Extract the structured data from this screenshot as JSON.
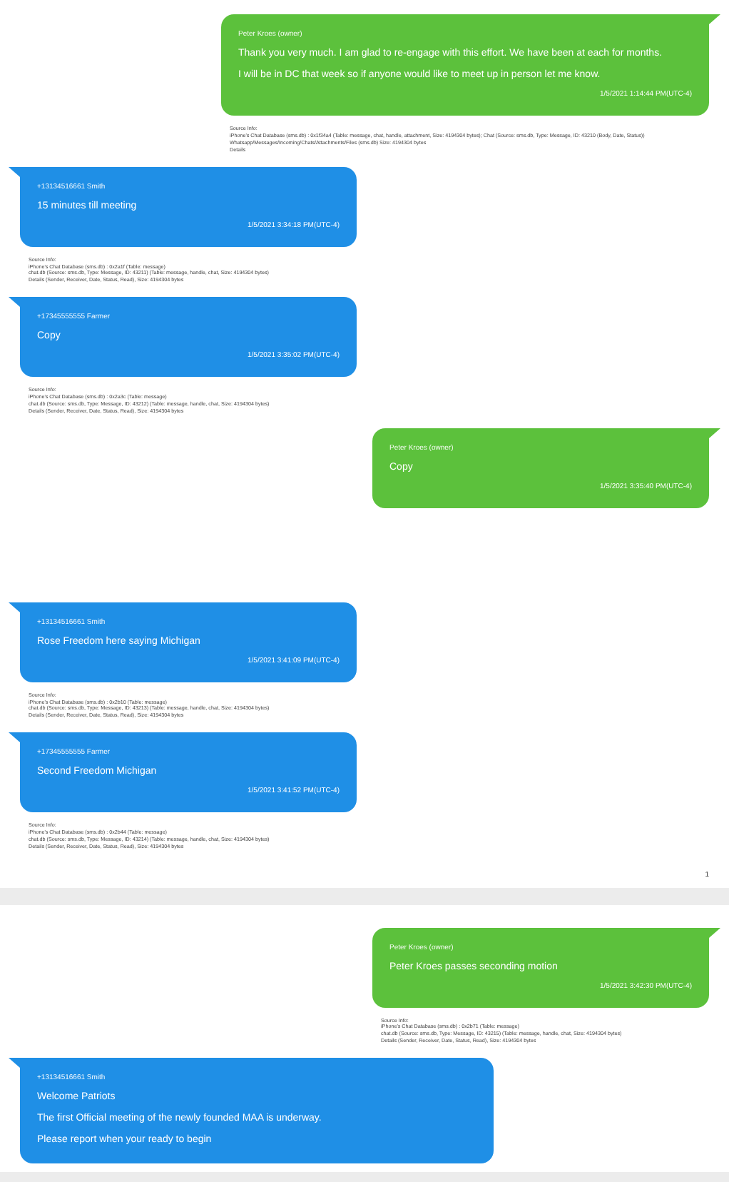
{
  "pages": [
    {
      "groups": [
        {
          "messages": [
            {
              "kind": "outgoing",
              "sender": "Peter Kroes (owner)",
              "lines": [
                "Thank you very much. I am glad to re-engage with this effort. We have been at each for months.",
                "I will be in DC that week so if anyone would like to meet up in person let me know."
              ],
              "timestamp": "1/5/2021 1:14:44 PM(UTC-4)",
              "meta": [
                "Source Info:",
                "iPhone's Chat Database (sms.db) : 0x1f34a4 (Table: message, chat, handle, attachment, Size: 4194304 bytes); Chat (Source: sms.db, Type: Message, ID: 43210 (Body, Date, Status))",
                "Whatsapp/Messages/Incoming/Chats/Attachments/Files (sms.db) Size: 4194304 bytes",
                "Details"
              ]
            },
            {
              "kind": "incoming",
              "sender": "+13134516661 Smith",
              "lines": [
                "15 minutes till meeting"
              ],
              "timestamp": "1/5/2021 3:34:18 PM(UTC-4)",
              "meta": [
                "Source Info:",
                "iPhone's Chat Database (sms.db) : 0x2a1f (Table: message)",
                "chat.db (Source: sms.db, Type: Message, ID: 43211) (Table: message, handle, chat, Size: 4194304 bytes)",
                "Details (Sender, Receiver, Date, Status, Read), Size: 4194304 bytes"
              ]
            },
            {
              "kind": "incoming",
              "sender": "+17345555555 Farmer",
              "lines": [
                "Copy"
              ],
              "timestamp": "1/5/2021 3:35:02 PM(UTC-4)",
              "meta": [
                "Source Info:",
                "iPhone's Chat Database (sms.db) : 0x2a3c (Table: message)",
                "chat.db (Source: sms.db, Type: Message, ID: 43212) (Table: message, handle, chat, Size: 4194304 bytes)",
                "Details (Sender, Receiver, Date, Status, Read), Size: 4194304 bytes"
              ]
            },
            {
              "kind": "outgoing",
              "sender": "Peter Kroes (owner)",
              "lines": [
                "Copy"
              ],
              "timestamp": "1/5/2021 3:35:40 PM(UTC-4)"
            }
          ]
        },
        {
          "messages": [
            {
              "kind": "incoming",
              "sender": "+13134516661 Smith",
              "lines": [
                "Rose Freedom here saying Michigan"
              ],
              "timestamp": "1/5/2021 3:41:09 PM(UTC-4)",
              "meta": [
                "Source Info:",
                "iPhone's Chat Database (sms.db) : 0x2b10 (Table: message)",
                "chat.db (Source: sms.db, Type: Message, ID: 43213) (Table: message, handle, chat, Size: 4194304 bytes)",
                "Details (Sender, Receiver, Date, Status, Read), Size: 4194304 bytes"
              ]
            },
            {
              "kind": "incoming",
              "sender": "+17345555555 Farmer",
              "lines": [
                "Second Freedom Michigan"
              ],
              "timestamp": "1/5/2021 3:41:52 PM(UTC-4)",
              "meta": [
                "Source Info:",
                "iPhone's Chat Database (sms.db) : 0x2b44 (Table: message)",
                "chat.db (Source: sms.db, Type: Message, ID: 43214) (Table: message, handle, chat, Size: 4194304 bytes)",
                "Details (Sender, Receiver, Date, Status, Read), Size: 4194304 bytes"
              ]
            }
          ]
        }
      ],
      "page_number": "1"
    },
    {
      "groups": [
        {
          "messages": [
            {
              "kind": "outgoing",
              "sender": "Peter Kroes (owner)",
              "lines": [
                "Peter Kroes passes seconding motion"
              ],
              "timestamp": "1/5/2021 3:42:30 PM(UTC-4)",
              "meta": [
                "Source Info:",
                "iPhone's Chat Database (sms.db) : 0x2b71 (Table: message)",
                "chat.db (Source: sms.db, Type: Message, ID: 43215) (Table: message, handle, chat, Size: 4194304 bytes)",
                "Details (Sender, Receiver, Date, Status, Read), Size: 4194304 bytes"
              ]
            },
            {
              "kind": "wide",
              "sender": "+13134516661 Smith",
              "lines": [
                "Welcome Patriots",
                "The first Official meeting of the newly founded MAA is underway.",
                "Please report when your ready to begin"
              ]
            }
          ]
        }
      ]
    }
  ]
}
